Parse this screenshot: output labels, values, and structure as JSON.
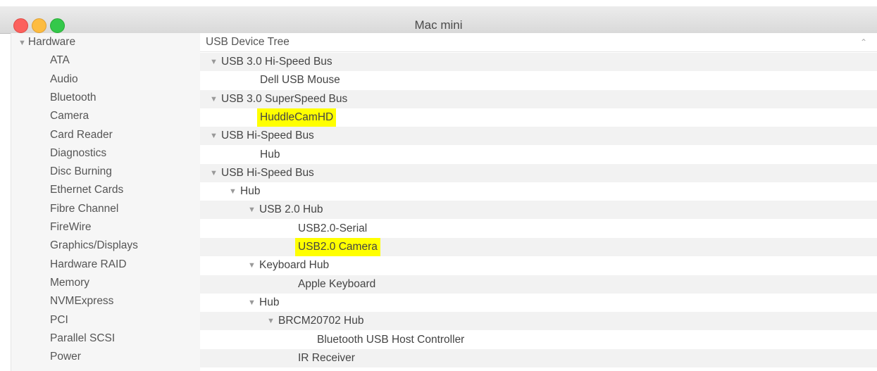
{
  "window": {
    "title": "Mac mini"
  },
  "sidebar": {
    "section": "Hardware",
    "items": [
      "ATA",
      "Audio",
      "Bluetooth",
      "Camera",
      "Card Reader",
      "Diagnostics",
      "Disc Burning",
      "Ethernet Cards",
      "Fibre Channel",
      "FireWire",
      "Graphics/Displays",
      "Hardware RAID",
      "Memory",
      "NVMExpress",
      "PCI",
      "Parallel SCSI",
      "Power"
    ]
  },
  "main": {
    "column_header": "USB Device Tree",
    "rows": [
      {
        "label": "USB 3.0 Hi-Speed Bus",
        "expanded": true,
        "highlighted": false
      },
      {
        "label": "Dell USB Mouse",
        "expanded": false,
        "highlighted": false
      },
      {
        "label": "USB 3.0 SuperSpeed Bus",
        "expanded": true,
        "highlighted": false
      },
      {
        "label": "HuddleCamHD",
        "expanded": false,
        "highlighted": true
      },
      {
        "label": "USB Hi-Speed Bus",
        "expanded": true,
        "highlighted": false
      },
      {
        "label": "Hub",
        "expanded": false,
        "highlighted": false
      },
      {
        "label": "USB Hi-Speed Bus",
        "expanded": true,
        "highlighted": false
      },
      {
        "label": "Hub",
        "expanded": true,
        "highlighted": false
      },
      {
        "label": "USB 2.0 Hub",
        "expanded": true,
        "highlighted": false
      },
      {
        "label": "USB2.0-Serial",
        "expanded": false,
        "highlighted": false
      },
      {
        "label": "USB2.0 Camera",
        "expanded": false,
        "highlighted": true
      },
      {
        "label": "Keyboard Hub",
        "expanded": true,
        "highlighted": false
      },
      {
        "label": "Apple Keyboard",
        "expanded": false,
        "highlighted": false
      },
      {
        "label": "Hub",
        "expanded": true,
        "highlighted": false
      },
      {
        "label": "BRCM20702 Hub",
        "expanded": true,
        "highlighted": false
      },
      {
        "label": "Bluetooth USB Host Controller",
        "expanded": false,
        "highlighted": false
      },
      {
        "label": "IR Receiver",
        "expanded": false,
        "highlighted": false
      }
    ]
  },
  "colors": {
    "highlight": "#ffff00",
    "close": "#fc615d",
    "minimize": "#fdbc40",
    "maximize": "#34c84a"
  }
}
